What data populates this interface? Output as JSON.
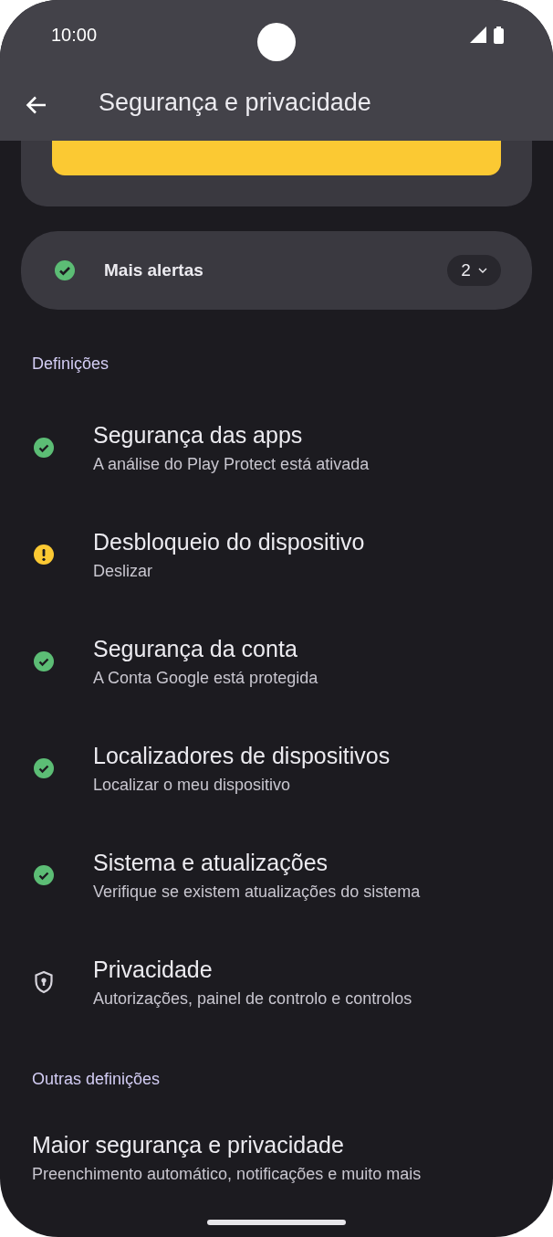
{
  "status_bar": {
    "time": "10:00"
  },
  "app_bar": {
    "title": "Segurança e privacidade"
  },
  "alerts": {
    "label": "Mais alertas",
    "count": "2"
  },
  "sections": [
    {
      "header": "Definições",
      "items": [
        {
          "kind": "ok",
          "title": "Segurança das apps",
          "subtitle": "A análise do Play Protect está ativada"
        },
        {
          "kind": "warning",
          "title": "Desbloqueio do dispositivo",
          "subtitle": "Deslizar"
        },
        {
          "kind": "ok",
          "title": "Segurança da conta",
          "subtitle": "A Conta Google está protegida"
        },
        {
          "kind": "ok",
          "title": "Localizadores de dispositivos",
          "subtitle": "Localizar o meu dispositivo"
        },
        {
          "kind": "ok",
          "title": "Sistema e atualizações",
          "subtitle": "Verifique se existem atualizações do sistema"
        },
        {
          "kind": "privacy",
          "title": "Privacidade",
          "subtitle": "Autorizações, painel de controlo e controlos"
        }
      ]
    },
    {
      "header": "Outras definições",
      "items": [
        {
          "kind": "plain",
          "title": "Maior segurança e privacidade",
          "subtitle": "Preenchimento automático, notificações e muito mais"
        }
      ]
    }
  ]
}
